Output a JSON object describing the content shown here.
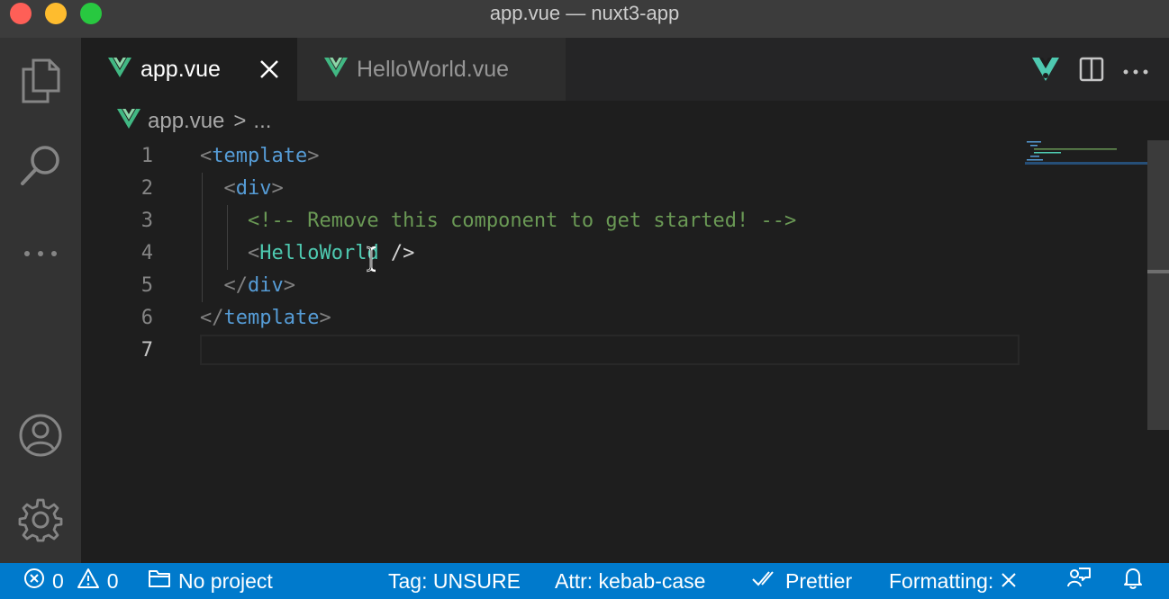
{
  "window": {
    "title": "app.vue — nuxt3-app"
  },
  "activity_bar": {
    "icons": [
      "files-icon",
      "search-icon",
      "more-icon",
      "account-icon",
      "settings-gear-icon"
    ]
  },
  "tabs": [
    {
      "label": "app.vue",
      "active": true
    },
    {
      "label": "HelloWorld.vue",
      "active": false
    }
  ],
  "breadcrumb": {
    "file": "app.vue",
    "separator": ">",
    "rest": "..."
  },
  "editor": {
    "lines": [
      {
        "number": "1",
        "parts": [
          "<",
          "template",
          ">"
        ]
      },
      {
        "number": "2",
        "parts": [
          "<",
          "div",
          ">"
        ]
      },
      {
        "number": "3",
        "parts": [
          "<!-- Remove this component to get started! -->"
        ]
      },
      {
        "number": "4",
        "parts": [
          "<",
          "HelloWorld",
          " />"
        ]
      },
      {
        "number": "5",
        "parts": [
          "</",
          "div",
          ">"
        ]
      },
      {
        "number": "6",
        "parts": [
          "</",
          "template",
          ">"
        ]
      },
      {
        "number": "7",
        "parts": []
      }
    ],
    "active_line": "7"
  },
  "status_bar": {
    "errors": "0",
    "warnings": "0",
    "project": "No project",
    "tag": "Tag: UNSURE",
    "attr": "Attr: kebab-case",
    "prettier": "Prettier",
    "formatting": "Formatting:"
  },
  "colors": {
    "accent": "#007acc",
    "vue_green": "#41b883",
    "tag_blue": "#569cd6",
    "component_teal": "#4ec9b0",
    "comment_green": "#6a9955"
  }
}
